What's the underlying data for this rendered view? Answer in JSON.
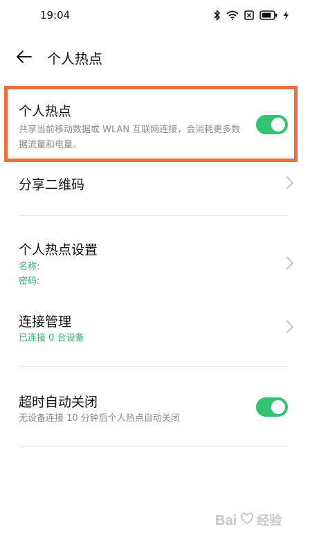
{
  "status_bar": {
    "time": "19:04",
    "icons": [
      "bluetooth-icon",
      "wifi-icon",
      "sim-icon",
      "battery-icon",
      "charging-icon"
    ]
  },
  "header": {
    "back_icon": "arrow-left-icon",
    "title": "个人热点"
  },
  "hotspot": {
    "title": "个人热点",
    "description": "共享当前移动数据或 WLAN 互联网连接，会消耗更多数据流量和电量。",
    "enabled": true
  },
  "share_qr": {
    "title": "分享二维码"
  },
  "hotspot_settings": {
    "title": "个人热点设置",
    "name_label": "名称:",
    "password_label": "密码:"
  },
  "connection_management": {
    "title": "连接管理",
    "status": "已连接 0 台设备"
  },
  "auto_off": {
    "title": "超时自动关闭",
    "description": "无设备连接 10 分钟后个人热点自动关闭",
    "enabled": true
  },
  "colors": {
    "accent_green": "#32c270",
    "highlight_orange": "#e8703a"
  },
  "watermark": {
    "text": "Bai经验"
  }
}
